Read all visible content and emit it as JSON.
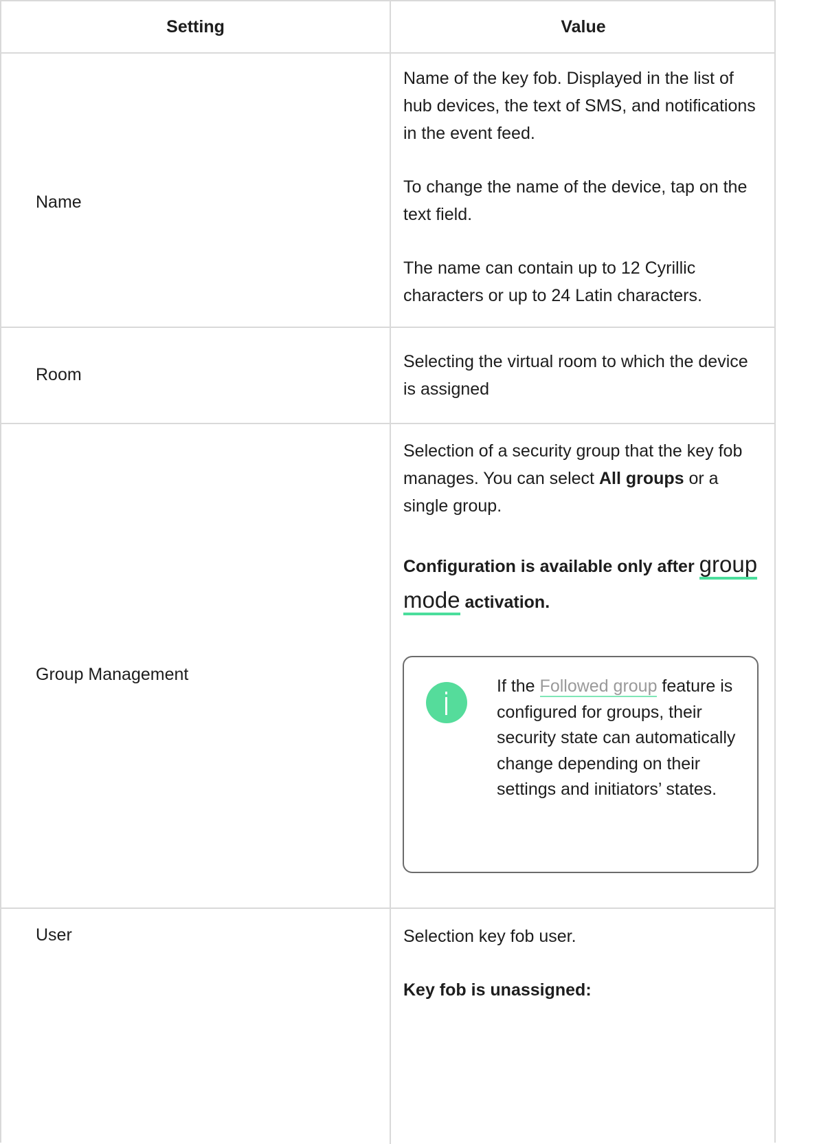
{
  "table": {
    "headers": {
      "setting": "Setting",
      "value": "Value"
    },
    "rows": {
      "name": {
        "setting": "Name",
        "p1": "Name of the key fob. Displayed in the list of hub devices, the text of SMS, and notifications in the event feed.",
        "p2": "To change the name of the device, tap on the text field.",
        "p3": "The name can contain up to 12 Cyrillic characters or up to 24 Latin characters."
      },
      "room": {
        "setting": "Room",
        "p1": "Selecting the virtual room to which the device is assigned"
      },
      "group": {
        "setting": "Group Management",
        "p1_before": "Selection of a security group that the key fob manages. You can select ",
        "p1_bold": "All groups",
        "p1_after": " or a single group.",
        "cfg_before": "Configuration is available only after ",
        "cfg_link_1": "group",
        "cfg_link_2": "mode",
        "cfg_after": " activation.",
        "note": {
          "icon": "info-icon",
          "before": "If the ",
          "link": "Followed group",
          "after": " feature is configured for groups, their security state can automatically change depending on their settings and initiators’ states."
        }
      },
      "user": {
        "setting": "User",
        "p1": "Selection key fob user.",
        "p2": "Key fob is unassigned:"
      }
    }
  }
}
